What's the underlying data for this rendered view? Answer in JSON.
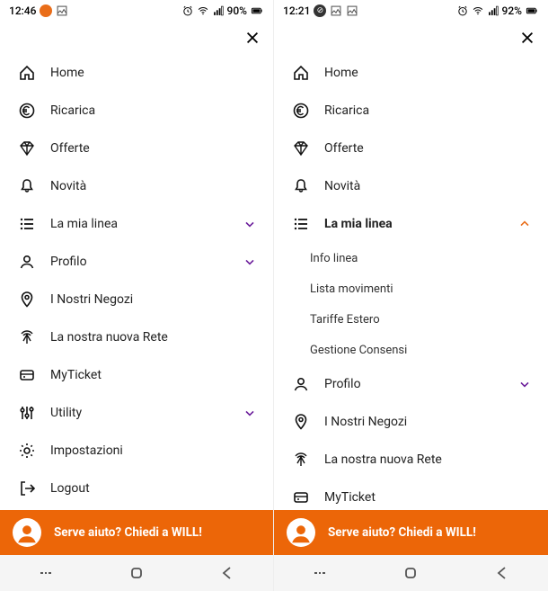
{
  "left": {
    "status": {
      "time": "12:46",
      "battery": "90%"
    },
    "menu": {
      "home": "Home",
      "ricarica": "Ricarica",
      "offerte": "Offerte",
      "novita": "Novità",
      "lamialinea": "La mia linea",
      "profilo": "Profilo",
      "negozi": "I Nostri Negozi",
      "rete": "La nostra nuova Rete",
      "myticket": "MyTicket",
      "utility": "Utility",
      "impostazioni": "Impostazioni",
      "logout": "Logout"
    },
    "help": "Serve aiuto? Chiedi a WILL!"
  },
  "right": {
    "status": {
      "time": "12:21",
      "battery": "92%"
    },
    "menu": {
      "home": "Home",
      "ricarica": "Ricarica",
      "offerte": "Offerte",
      "novita": "Novità",
      "lamialinea": "La mia linea",
      "sub": {
        "infolinea": "Info linea",
        "listamov": "Lista movimenti",
        "tariffe": "Tariffe Estero",
        "consensi": "Gestione Consensi"
      },
      "profilo": "Profilo",
      "negozi": "I Nostri Negozi",
      "rete": "La nostra nuova Rete",
      "myticket": "MyTicket"
    },
    "help": "Serve aiuto? Chiedi a WILL!"
  },
  "colors": {
    "accent": "#ec6608",
    "chevron": "#6a1b9a"
  }
}
